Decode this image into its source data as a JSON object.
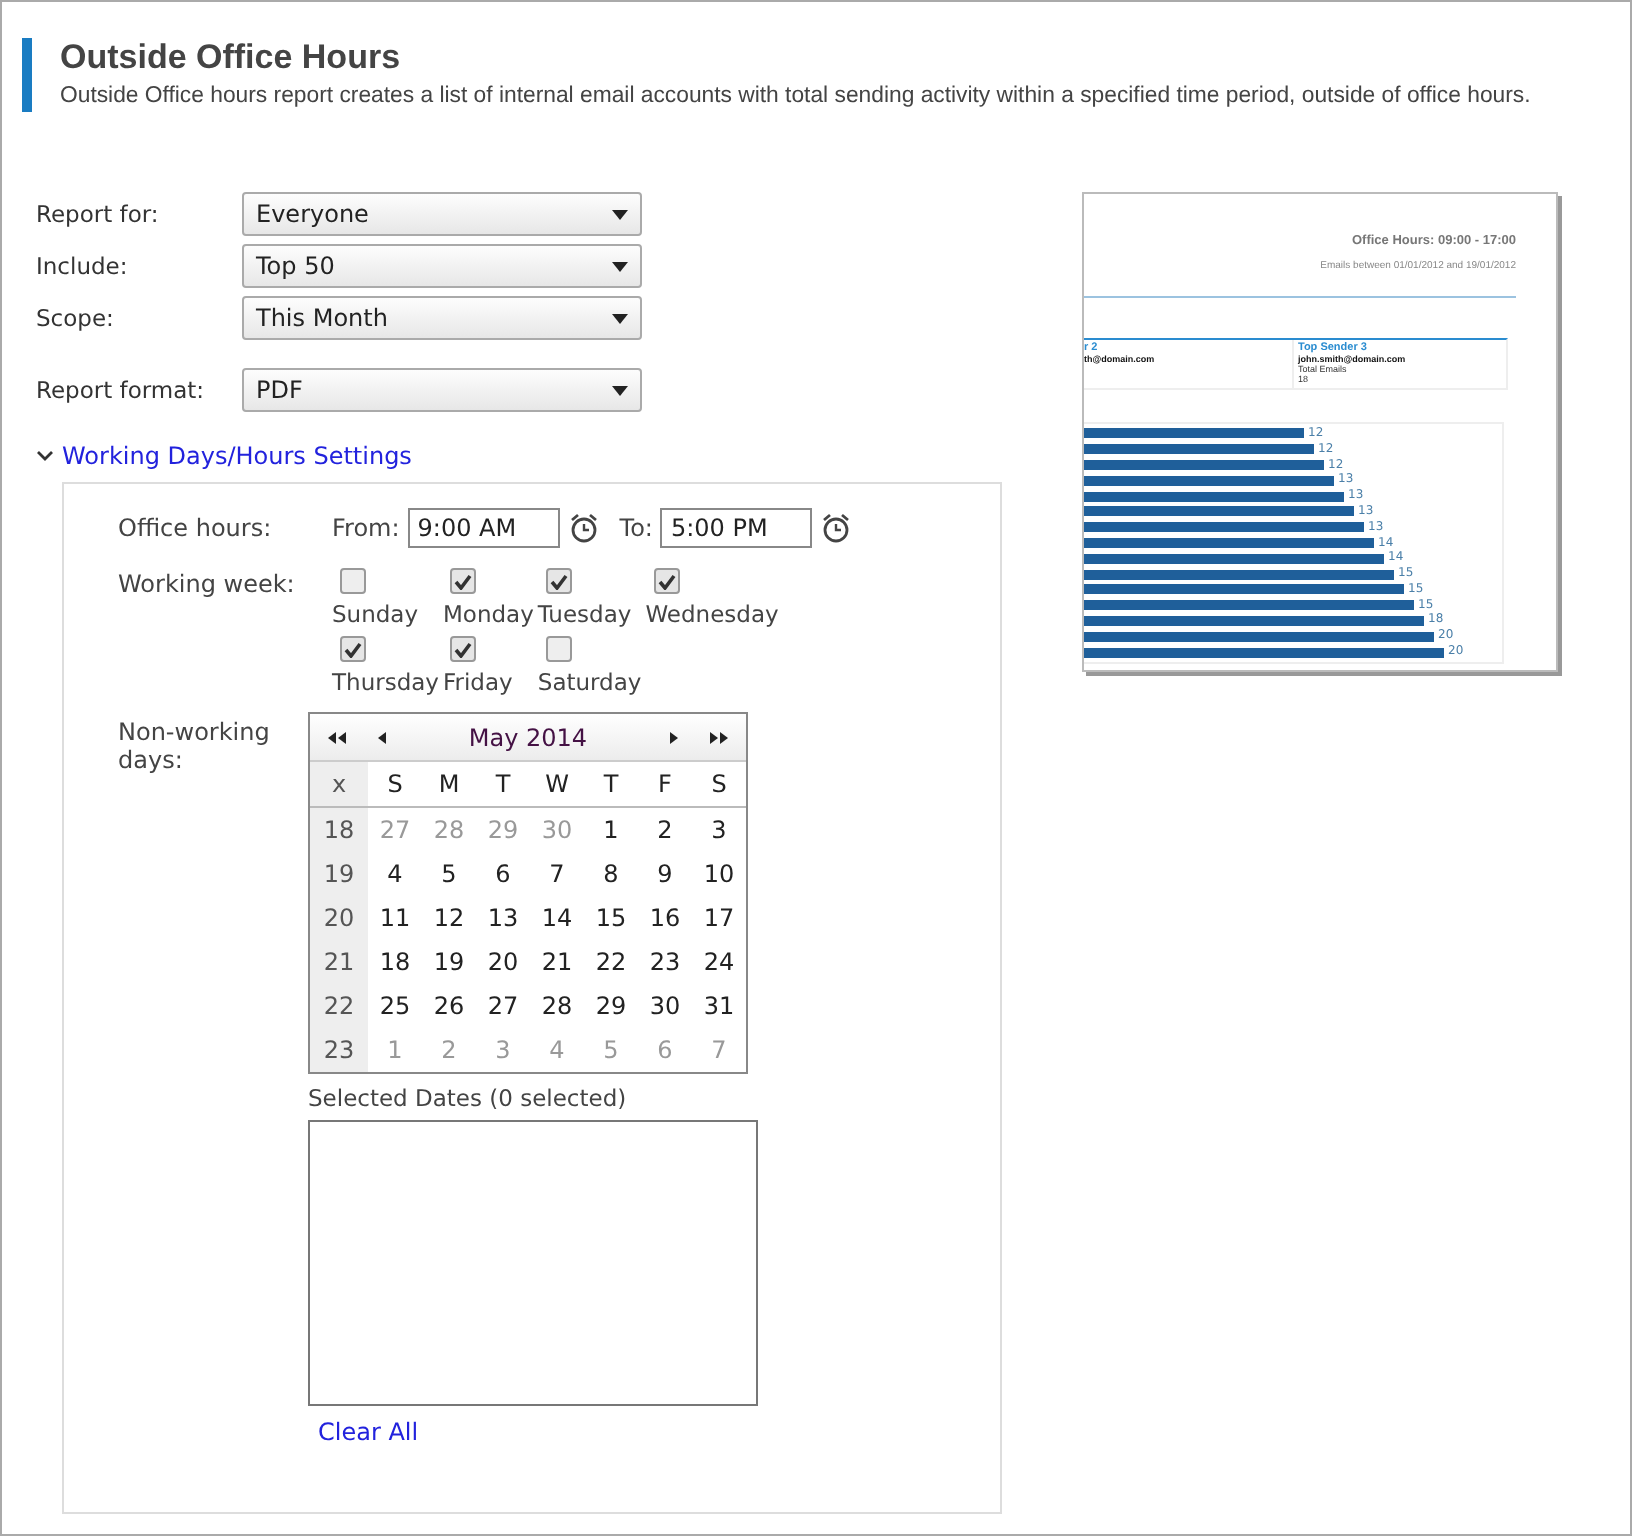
{
  "header": {
    "title": "Outside Office Hours",
    "description": "Outside Office hours report creates a list of internal email accounts with total sending activity within a specified time period, outside of office hours."
  },
  "fields": [
    {
      "label": "Report for:",
      "value": "Everyone"
    },
    {
      "label": "Include:",
      "value": "Top 50"
    },
    {
      "label": "Scope:",
      "value": "This Month"
    },
    {
      "label": "Report format:",
      "value": "PDF"
    }
  ],
  "preview": {
    "heading": "Office Hours: 09:00 - 17:00",
    "subheading": "Emails between 01/01/2012 and 19/01/2012",
    "senders": [
      {
        "title": "r 2",
        "email": "th@domain.com"
      },
      {
        "title": "Top Sender 3",
        "email": "john.smith@domain.com",
        "stat_label": "Total Emails",
        "stat_value": "18"
      }
    ],
    "bar_labels": [
      "12",
      "12",
      "12",
      "13",
      "13",
      "13",
      "13",
      "14",
      "14",
      "15",
      "15",
      "15",
      "18",
      "20",
      "20"
    ]
  },
  "settings": {
    "label": "Working Days/Hours Settings",
    "expanded": true,
    "office_hours": {
      "label": "Office hours:",
      "from_label": "From:",
      "from_value": "9:00 AM",
      "to_label": "To:",
      "to_value": "5:00 PM"
    },
    "working_week": {
      "label": "Working week:",
      "days": [
        {
          "label": "Sunday",
          "checked": false
        },
        {
          "label": "Monday",
          "checked": true
        },
        {
          "label": "Tuesday",
          "checked": true
        },
        {
          "label": "Wednesday",
          "checked": true
        },
        {
          "label": "Thursday",
          "checked": true
        },
        {
          "label": "Friday",
          "checked": true
        },
        {
          "label": "Saturday",
          "checked": false
        }
      ]
    },
    "non_working": {
      "label": "Non-working days:",
      "calendar": {
        "title": "May 2014",
        "headers": [
          "x",
          "S",
          "M",
          "T",
          "W",
          "T",
          "F",
          "S"
        ],
        "weeks": [
          {
            "week": "18",
            "days": [
              {
                "day": "27",
                "other_month": true
              },
              {
                "day": "28",
                "other_month": true
              },
              {
                "day": "29",
                "other_month": true
              },
              {
                "day": "30",
                "other_month": true
              },
              {
                "day": "1",
                "other_month": false
              },
              {
                "day": "2",
                "other_month": false
              },
              {
                "day": "3",
                "other_month": false
              }
            ]
          },
          {
            "week": "19",
            "days": [
              {
                "day": "4",
                "other_month": false
              },
              {
                "day": "5",
                "other_month": false
              },
              {
                "day": "6",
                "other_month": false
              },
              {
                "day": "7",
                "other_month": false
              },
              {
                "day": "8",
                "other_month": false
              },
              {
                "day": "9",
                "other_month": false
              },
              {
                "day": "10",
                "other_month": false
              }
            ]
          },
          {
            "week": "20",
            "days": [
              {
                "day": "11",
                "other_month": false
              },
              {
                "day": "12",
                "other_month": false
              },
              {
                "day": "13",
                "other_month": false
              },
              {
                "day": "14",
                "other_month": false
              },
              {
                "day": "15",
                "other_month": false
              },
              {
                "day": "16",
                "other_month": false
              },
              {
                "day": "17",
                "other_month": false
              }
            ]
          },
          {
            "week": "21",
            "days": [
              {
                "day": "18",
                "other_month": false
              },
              {
                "day": "19",
                "other_month": false
              },
              {
                "day": "20",
                "other_month": false
              },
              {
                "day": "21",
                "other_month": false
              },
              {
                "day": "22",
                "other_month": false
              },
              {
                "day": "23",
                "other_month": false
              },
              {
                "day": "24",
                "other_month": false
              }
            ]
          },
          {
            "week": "22",
            "days": [
              {
                "day": "25",
                "other_month": false
              },
              {
                "day": "26",
                "other_month": false
              },
              {
                "day": "27",
                "other_month": false
              },
              {
                "day": "28",
                "other_month": false
              },
              {
                "day": "29",
                "other_month": false
              },
              {
                "day": "30",
                "other_month": false
              },
              {
                "day": "31",
                "other_month": false
              }
            ]
          },
          {
            "week": "23",
            "days": [
              {
                "day": "1",
                "other_month": true
              },
              {
                "day": "2",
                "other_month": true
              },
              {
                "day": "3",
                "other_month": true
              },
              {
                "day": "4",
                "other_month": true
              },
              {
                "day": "5",
                "other_month": true
              },
              {
                "day": "6",
                "other_month": true
              },
              {
                "day": "7",
                "other_month": true
              }
            ]
          }
        ]
      },
      "selected_label": "Selected Dates (0 selected)",
      "clear_label": "Clear All"
    }
  }
}
